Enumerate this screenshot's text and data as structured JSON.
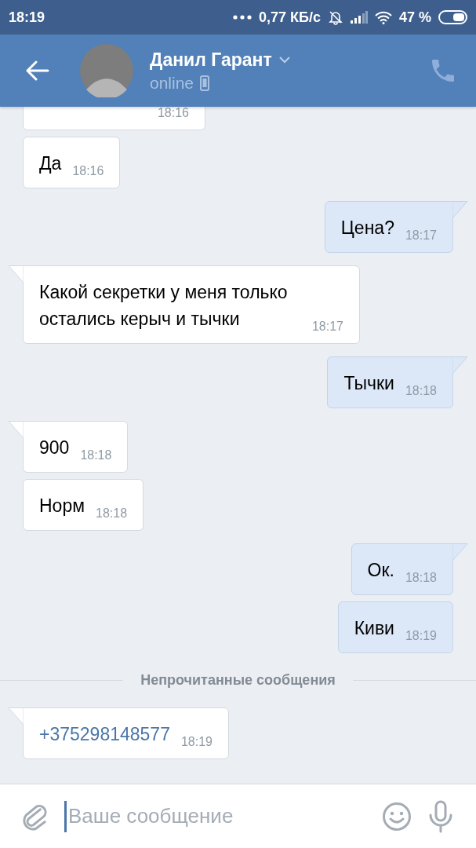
{
  "status_bar": {
    "time": "18:19",
    "speed": "0,77 КБ/с",
    "battery": "47 %"
  },
  "header": {
    "name": "Данил Гарант",
    "status": "online"
  },
  "messages": [
    {
      "kind": "cut",
      "outgoing": false,
      "time": "18:16"
    },
    {
      "kind": "text",
      "outgoing": false,
      "text": "Да",
      "time": "18:16",
      "tail": false
    },
    {
      "kind": "text",
      "outgoing": true,
      "text": "Цена?",
      "time": "18:17",
      "tail": true
    },
    {
      "kind": "text",
      "outgoing": false,
      "text": "Какой секретки у меня только остались керыч и тычки",
      "time": "18:17",
      "tail": true
    },
    {
      "kind": "text",
      "outgoing": true,
      "text": "Тычки",
      "time": "18:18",
      "tail": true
    },
    {
      "kind": "text",
      "outgoing": false,
      "text": "900",
      "time": "18:18",
      "tail": true
    },
    {
      "kind": "text",
      "outgoing": false,
      "text": "Норм",
      "time": "18:18",
      "tail": false
    },
    {
      "kind": "text",
      "outgoing": true,
      "text": "Ок.",
      "time": "18:18",
      "tail": true
    },
    {
      "kind": "text",
      "outgoing": true,
      "text": "Киви",
      "time": "18:19",
      "tail": false
    },
    {
      "kind": "divider",
      "text": "Непрочитанные сообщения"
    },
    {
      "kind": "phone",
      "outgoing": false,
      "text": "+375298148577",
      "time": "18:19",
      "tail": true
    }
  ],
  "composer": {
    "placeholder": "Ваше сообщение"
  }
}
